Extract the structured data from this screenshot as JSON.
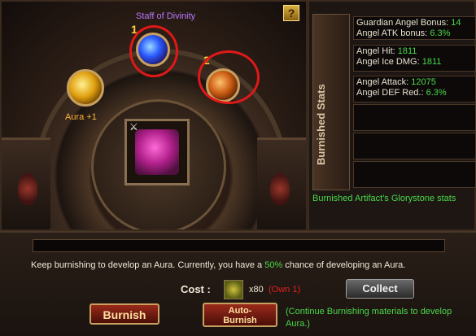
{
  "artifact": {
    "name": "Staff of Divinity",
    "slot1_number": "1",
    "slot2_number": "2",
    "aura_label": "Aura +1"
  },
  "help": {
    "label": "?"
  },
  "stats_panel": {
    "tab_label": "Burnished Stats",
    "rows": [
      {
        "label": "Guardian Angel Bonus:",
        "value": "14"
      },
      {
        "label": "Angel ATK bonus:",
        "value": "6.3%"
      },
      {
        "label": "Angel Hit:",
        "value": "1811"
      },
      {
        "label": "Angel Ice DMG:",
        "value": "1811"
      },
      {
        "label": "Angel Attack:",
        "value": "12075"
      },
      {
        "label": "Angel DEF Red.:",
        "value": "6.3%"
      }
    ],
    "footer": "Burnished Artifact's Glorystone stats"
  },
  "burnish": {
    "message_pre": "Keep burnishing to develop an Aura. Currently, you have a ",
    "message_pct": "50%",
    "message_post": " chance of developing an Aura.",
    "cost_label": "Cost :",
    "cost_qty": "x80",
    "cost_own": "(Own 1)",
    "collect_label": "Collect",
    "burnish_label": "Burnish",
    "auto_label_1": "Auto-",
    "auto_label_2": "Burnish",
    "continue_note": "(Continue Burnishing materials to develop Aura.)"
  },
  "colors": {
    "green": "#4ad84a",
    "red": "#e02020",
    "purple": "#b878ff",
    "gold": "#ffd23a"
  }
}
